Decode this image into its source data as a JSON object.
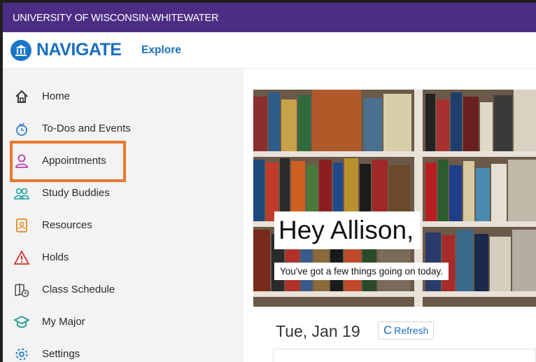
{
  "topbar": {
    "university": "UNIVERSITY OF WISCONSIN-WHITEWATER"
  },
  "navbar": {
    "logo_text": "NAVIGATE",
    "explore_label": "Explore"
  },
  "sidebar": {
    "items": [
      {
        "label": "Home",
        "icon": "home-icon"
      },
      {
        "label": "To-Dos and Events",
        "icon": "todos-icon"
      },
      {
        "label": "Appointments",
        "icon": "person-icon"
      },
      {
        "label": "Study Buddies",
        "icon": "group-icon"
      },
      {
        "label": "Resources",
        "icon": "resources-icon"
      },
      {
        "label": "Holds",
        "icon": "warning-icon"
      },
      {
        "label": "Class Schedule",
        "icon": "schedule-icon"
      },
      {
        "label": "My Major",
        "icon": "graduation-cap-icon"
      },
      {
        "label": "Settings",
        "icon": "gear-icon"
      }
    ],
    "highlight_color": "#e8772e"
  },
  "main": {
    "greeting": "Hey Allison,",
    "subtitle": "You've got a few things going on today.",
    "date": "Tue, Jan 19",
    "refresh_label": "Refresh"
  },
  "colors": {
    "brand_purple": "#4b2e83",
    "link_blue": "#1a6fc0"
  }
}
